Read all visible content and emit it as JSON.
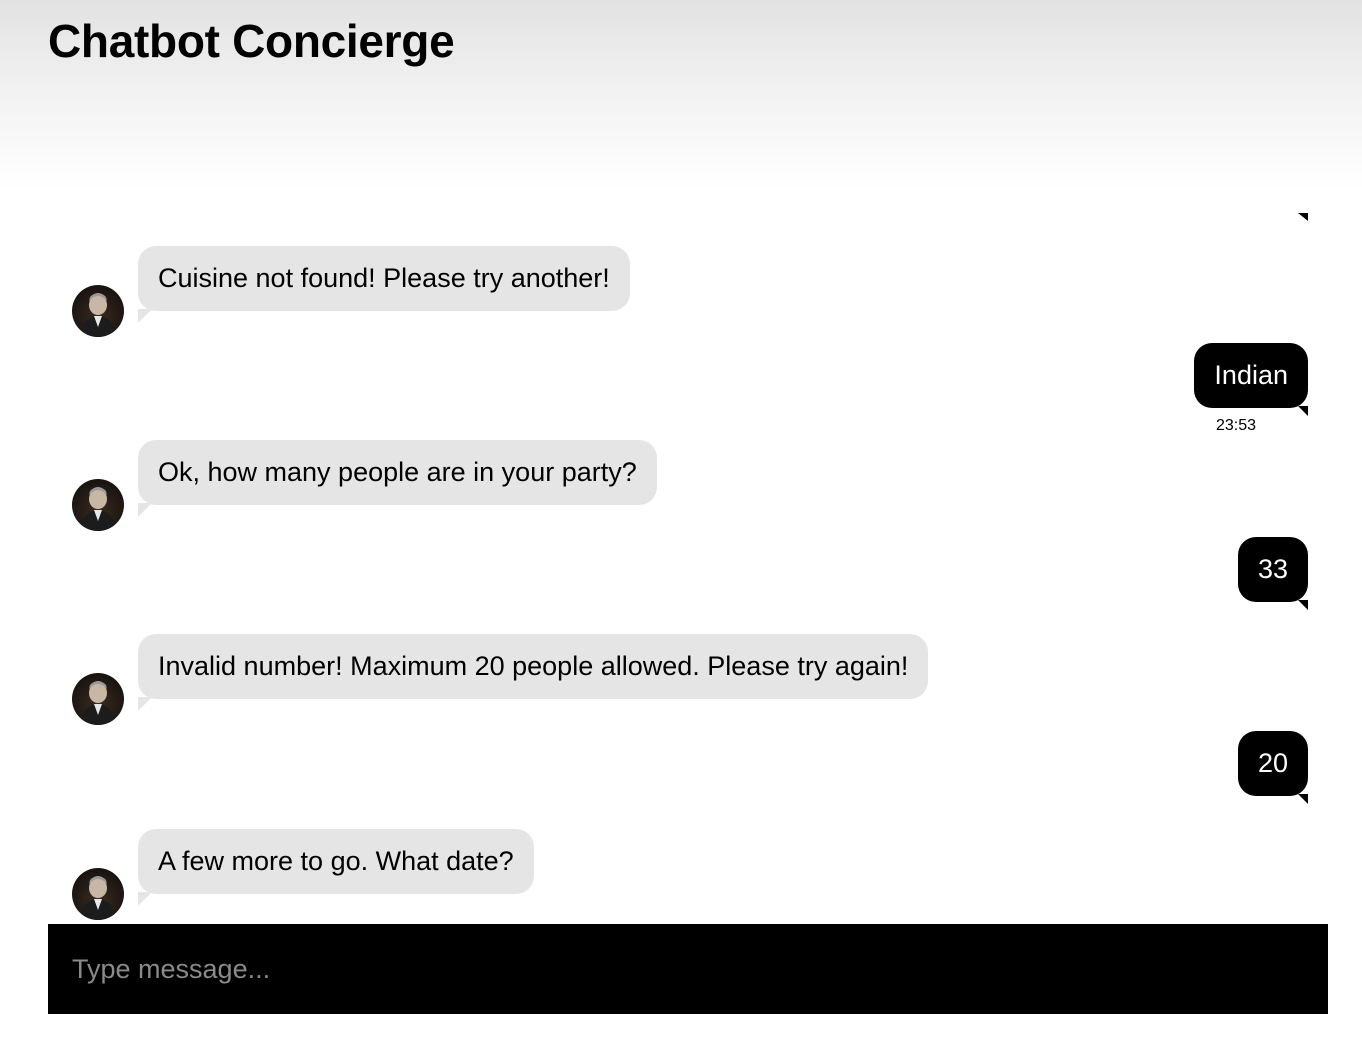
{
  "header": {
    "title": "Chatbot Concierge"
  },
  "messages": [
    {
      "sender": "bot",
      "text": "Cuisine not found! Please try another!"
    },
    {
      "sender": "user",
      "text": "Indian",
      "time": "23:53"
    },
    {
      "sender": "bot",
      "text": "Ok, how many people are in your party?"
    },
    {
      "sender": "user",
      "text": "33"
    },
    {
      "sender": "bot",
      "text": "Invalid number! Maximum 20 people allowed. Please try again!"
    },
    {
      "sender": "user",
      "text": "20"
    },
    {
      "sender": "bot",
      "text": "A few more to go. What date?"
    }
  ],
  "input": {
    "placeholder": "Type message..."
  },
  "colors": {
    "bot_bubble": "#e5e5e5",
    "user_bubble": "#000000",
    "input_bar": "#000000"
  },
  "icons": {
    "bot_avatar": "concierge-avatar"
  }
}
